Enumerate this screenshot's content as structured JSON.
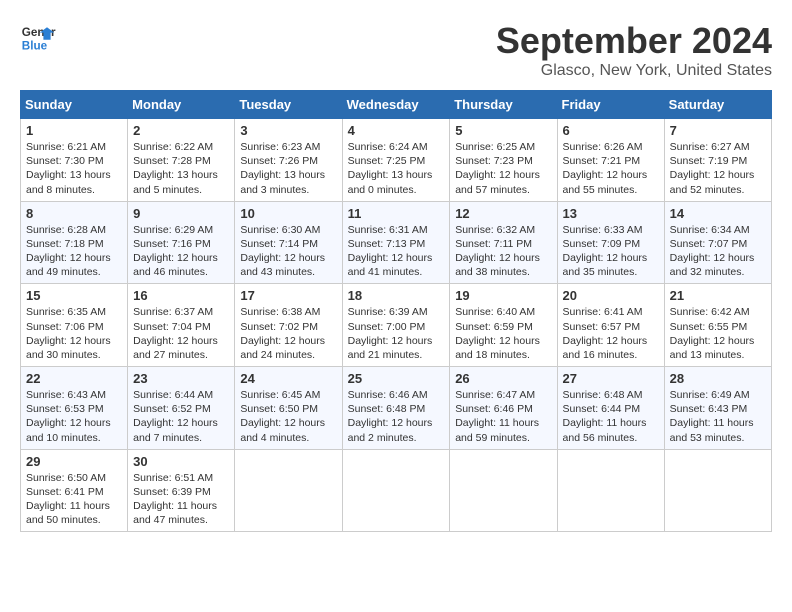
{
  "logo": {
    "line1": "General",
    "line2": "Blue"
  },
  "title": "September 2024",
  "location": "Glasco, New York, United States",
  "days_of_week": [
    "Sunday",
    "Monday",
    "Tuesday",
    "Wednesday",
    "Thursday",
    "Friday",
    "Saturday"
  ],
  "weeks": [
    [
      {
        "day": "1",
        "sunrise": "Sunrise: 6:21 AM",
        "sunset": "Sunset: 7:30 PM",
        "daylight": "Daylight: 13 hours and 8 minutes."
      },
      {
        "day": "2",
        "sunrise": "Sunrise: 6:22 AM",
        "sunset": "Sunset: 7:28 PM",
        "daylight": "Daylight: 13 hours and 5 minutes."
      },
      {
        "day": "3",
        "sunrise": "Sunrise: 6:23 AM",
        "sunset": "Sunset: 7:26 PM",
        "daylight": "Daylight: 13 hours and 3 minutes."
      },
      {
        "day": "4",
        "sunrise": "Sunrise: 6:24 AM",
        "sunset": "Sunset: 7:25 PM",
        "daylight": "Daylight: 13 hours and 0 minutes."
      },
      {
        "day": "5",
        "sunrise": "Sunrise: 6:25 AM",
        "sunset": "Sunset: 7:23 PM",
        "daylight": "Daylight: 12 hours and 57 minutes."
      },
      {
        "day": "6",
        "sunrise": "Sunrise: 6:26 AM",
        "sunset": "Sunset: 7:21 PM",
        "daylight": "Daylight: 12 hours and 55 minutes."
      },
      {
        "day": "7",
        "sunrise": "Sunrise: 6:27 AM",
        "sunset": "Sunset: 7:19 PM",
        "daylight": "Daylight: 12 hours and 52 minutes."
      }
    ],
    [
      {
        "day": "8",
        "sunrise": "Sunrise: 6:28 AM",
        "sunset": "Sunset: 7:18 PM",
        "daylight": "Daylight: 12 hours and 49 minutes."
      },
      {
        "day": "9",
        "sunrise": "Sunrise: 6:29 AM",
        "sunset": "Sunset: 7:16 PM",
        "daylight": "Daylight: 12 hours and 46 minutes."
      },
      {
        "day": "10",
        "sunrise": "Sunrise: 6:30 AM",
        "sunset": "Sunset: 7:14 PM",
        "daylight": "Daylight: 12 hours and 43 minutes."
      },
      {
        "day": "11",
        "sunrise": "Sunrise: 6:31 AM",
        "sunset": "Sunset: 7:13 PM",
        "daylight": "Daylight: 12 hours and 41 minutes."
      },
      {
        "day": "12",
        "sunrise": "Sunrise: 6:32 AM",
        "sunset": "Sunset: 7:11 PM",
        "daylight": "Daylight: 12 hours and 38 minutes."
      },
      {
        "day": "13",
        "sunrise": "Sunrise: 6:33 AM",
        "sunset": "Sunset: 7:09 PM",
        "daylight": "Daylight: 12 hours and 35 minutes."
      },
      {
        "day": "14",
        "sunrise": "Sunrise: 6:34 AM",
        "sunset": "Sunset: 7:07 PM",
        "daylight": "Daylight: 12 hours and 32 minutes."
      }
    ],
    [
      {
        "day": "15",
        "sunrise": "Sunrise: 6:35 AM",
        "sunset": "Sunset: 7:06 PM",
        "daylight": "Daylight: 12 hours and 30 minutes."
      },
      {
        "day": "16",
        "sunrise": "Sunrise: 6:37 AM",
        "sunset": "Sunset: 7:04 PM",
        "daylight": "Daylight: 12 hours and 27 minutes."
      },
      {
        "day": "17",
        "sunrise": "Sunrise: 6:38 AM",
        "sunset": "Sunset: 7:02 PM",
        "daylight": "Daylight: 12 hours and 24 minutes."
      },
      {
        "day": "18",
        "sunrise": "Sunrise: 6:39 AM",
        "sunset": "Sunset: 7:00 PM",
        "daylight": "Daylight: 12 hours and 21 minutes."
      },
      {
        "day": "19",
        "sunrise": "Sunrise: 6:40 AM",
        "sunset": "Sunset: 6:59 PM",
        "daylight": "Daylight: 12 hours and 18 minutes."
      },
      {
        "day": "20",
        "sunrise": "Sunrise: 6:41 AM",
        "sunset": "Sunset: 6:57 PM",
        "daylight": "Daylight: 12 hours and 16 minutes."
      },
      {
        "day": "21",
        "sunrise": "Sunrise: 6:42 AM",
        "sunset": "Sunset: 6:55 PM",
        "daylight": "Daylight: 12 hours and 13 minutes."
      }
    ],
    [
      {
        "day": "22",
        "sunrise": "Sunrise: 6:43 AM",
        "sunset": "Sunset: 6:53 PM",
        "daylight": "Daylight: 12 hours and 10 minutes."
      },
      {
        "day": "23",
        "sunrise": "Sunrise: 6:44 AM",
        "sunset": "Sunset: 6:52 PM",
        "daylight": "Daylight: 12 hours and 7 minutes."
      },
      {
        "day": "24",
        "sunrise": "Sunrise: 6:45 AM",
        "sunset": "Sunset: 6:50 PM",
        "daylight": "Daylight: 12 hours and 4 minutes."
      },
      {
        "day": "25",
        "sunrise": "Sunrise: 6:46 AM",
        "sunset": "Sunset: 6:48 PM",
        "daylight": "Daylight: 12 hours and 2 minutes."
      },
      {
        "day": "26",
        "sunrise": "Sunrise: 6:47 AM",
        "sunset": "Sunset: 6:46 PM",
        "daylight": "Daylight: 11 hours and 59 minutes."
      },
      {
        "day": "27",
        "sunrise": "Sunrise: 6:48 AM",
        "sunset": "Sunset: 6:44 PM",
        "daylight": "Daylight: 11 hours and 56 minutes."
      },
      {
        "day": "28",
        "sunrise": "Sunrise: 6:49 AM",
        "sunset": "Sunset: 6:43 PM",
        "daylight": "Daylight: 11 hours and 53 minutes."
      }
    ],
    [
      {
        "day": "29",
        "sunrise": "Sunrise: 6:50 AM",
        "sunset": "Sunset: 6:41 PM",
        "daylight": "Daylight: 11 hours and 50 minutes."
      },
      {
        "day": "30",
        "sunrise": "Sunrise: 6:51 AM",
        "sunset": "Sunset: 6:39 PM",
        "daylight": "Daylight: 11 hours and 47 minutes."
      },
      null,
      null,
      null,
      null,
      null
    ]
  ]
}
